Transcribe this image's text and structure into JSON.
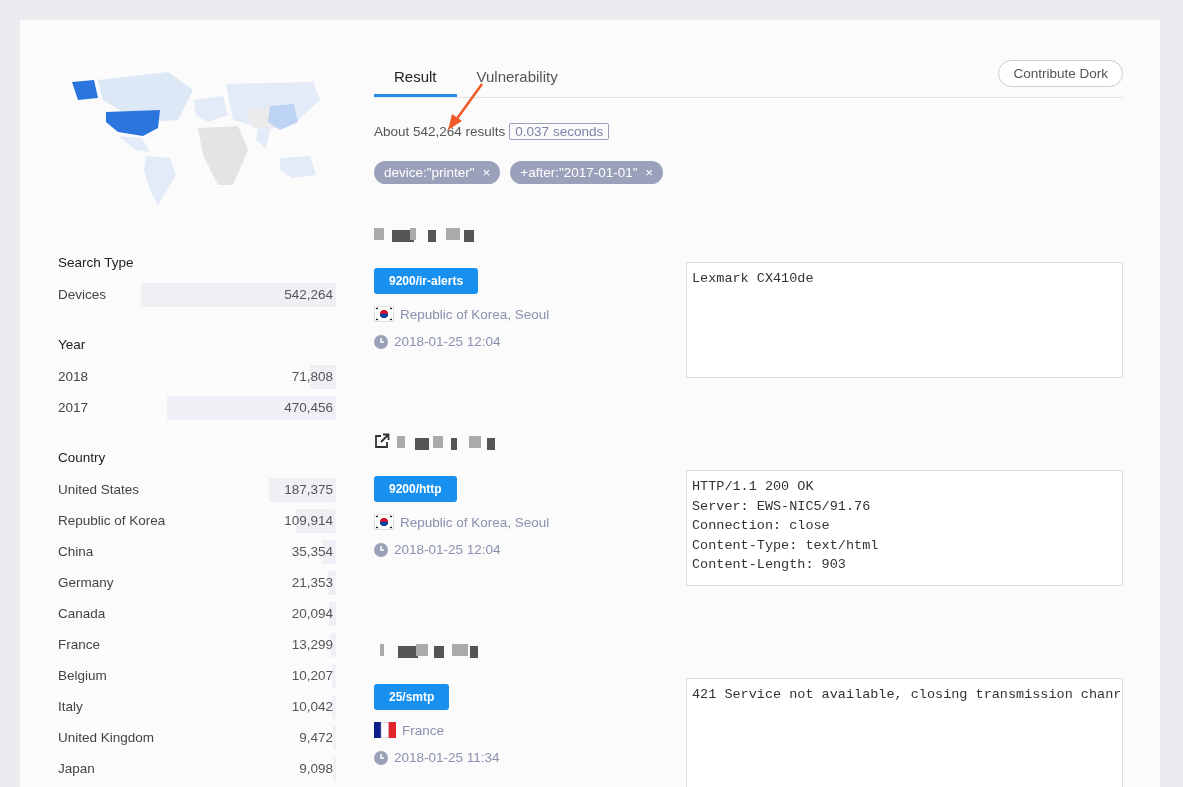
{
  "facets": [
    {
      "title": "Search Type",
      "items": [
        {
          "label": "Devices",
          "count": "542,264"
        }
      ]
    },
    {
      "title": "Year",
      "items": [
        {
          "label": "2018",
          "count": "71,808"
        },
        {
          "label": "2017",
          "count": "470,456"
        }
      ]
    },
    {
      "title": "Country",
      "items": [
        {
          "label": "United States",
          "count": "187,375"
        },
        {
          "label": "Republic of Korea",
          "count": "109,914"
        },
        {
          "label": "China",
          "count": "35,354"
        },
        {
          "label": "Germany",
          "count": "21,353"
        },
        {
          "label": "Canada",
          "count": "20,094"
        },
        {
          "label": "France",
          "count": "13,299"
        },
        {
          "label": "Belgium",
          "count": "10,207"
        },
        {
          "label": "Italy",
          "count": "10,042"
        },
        {
          "label": "United Kingdom",
          "count": "9,472"
        },
        {
          "label": "Japan",
          "count": "9,098"
        }
      ]
    }
  ],
  "tabs": [
    {
      "label": "Result",
      "selected": true
    },
    {
      "label": "Vulnerability",
      "selected": false
    }
  ],
  "contribute_button": "Contribute Dork",
  "summary": {
    "text": "About 542,264 results",
    "time": "0.037 seconds"
  },
  "filters": [
    {
      "label": "device:\"printer\"",
      "remove": "×"
    },
    {
      "label": "+after:\"2017-01-01\"",
      "remove": "×"
    }
  ],
  "results": [
    {
      "external_link": false,
      "port": "9200/ir-alerts",
      "kind": "korea",
      "location": "Republic of Korea, Seoul",
      "time": "2018-01-25 12:04",
      "banner": [
        "Lexmark CX410de"
      ]
    },
    {
      "external_link": true,
      "port": "9200/http",
      "kind": "korea",
      "location": "Republic of Korea, Seoul",
      "time": "2018-01-25 12:04",
      "banner": [
        "HTTP/1.1 200 OK",
        "Server: EWS-NIC5/91.76",
        "Connection: close",
        "Content-Type: text/html",
        "Content-Length: 903"
      ]
    },
    {
      "external_link": false,
      "port": "25/smtp",
      "kind": "france",
      "location": "France",
      "time": "2018-01-25 11:34",
      "banner": [
        "421 Service not available, closing transmission chanr"
      ]
    }
  ]
}
